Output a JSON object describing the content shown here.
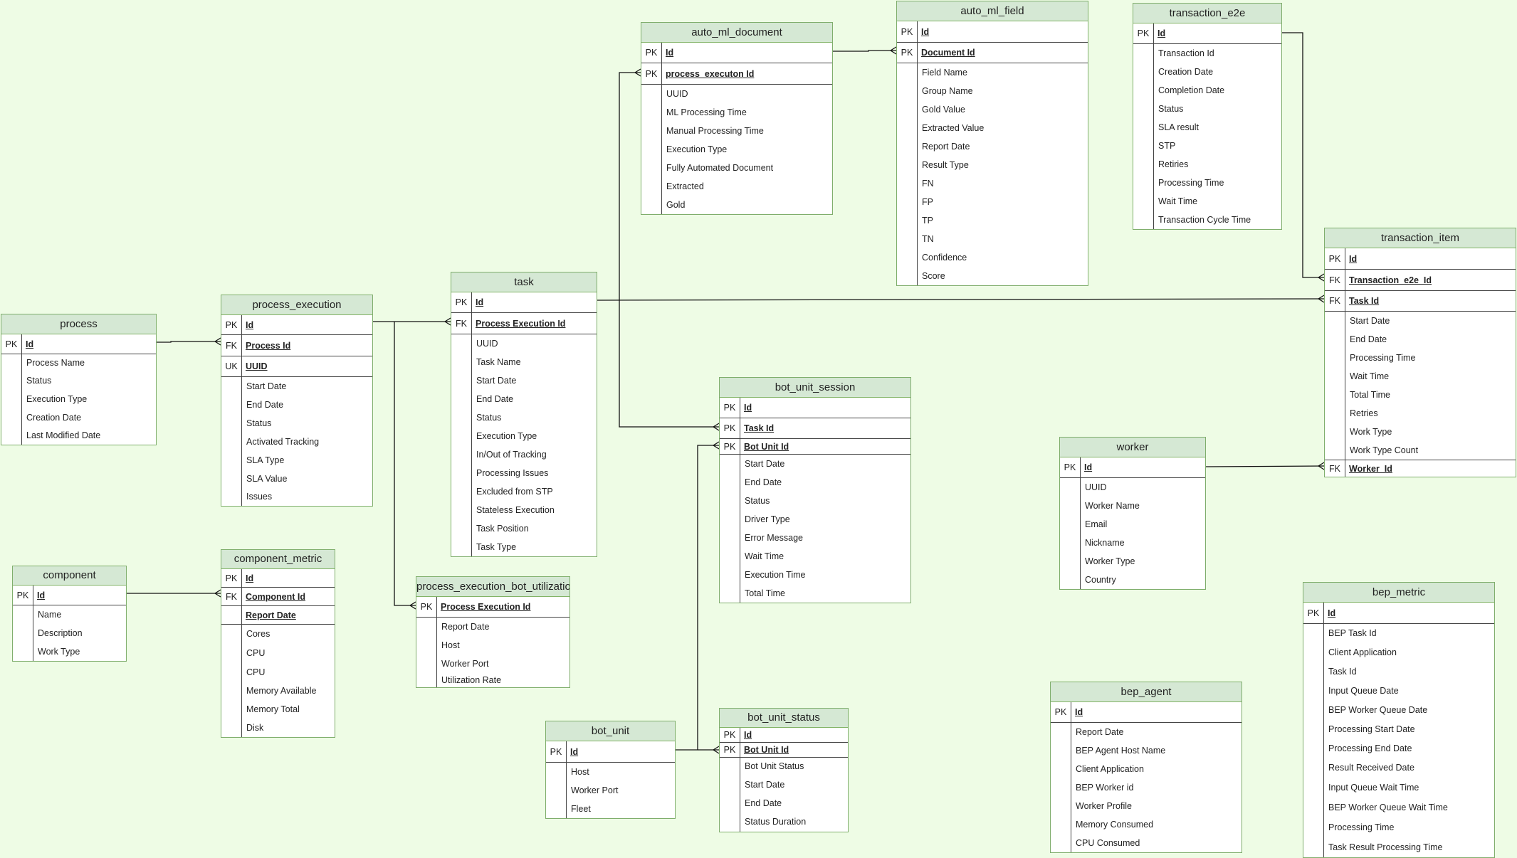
{
  "diagram": {
    "entities": [
      {
        "id": "process",
        "title": "process",
        "keys": [
          [
            "PK",
            "Id"
          ]
        ],
        "attrs": [
          "Process Name",
          "Status",
          "Execution Type",
          "Creation Date",
          "Last Modified Date"
        ]
      },
      {
        "id": "process_execution",
        "title": "process_execution",
        "keys": [
          [
            "PK",
            "Id"
          ],
          [
            "FK",
            "Process Id"
          ],
          [
            "UK",
            "UUID"
          ]
        ],
        "attrs": [
          "Start Date",
          "End Date",
          "Status",
          "Activated Tracking",
          "SLA Type",
          "SLA Value",
          "Issues"
        ]
      },
      {
        "id": "task",
        "title": "task",
        "keys": [
          [
            "PK",
            "Id"
          ],
          [
            "FK",
            "Process Execution Id"
          ]
        ],
        "attrs": [
          "UUID",
          "Task Name",
          "Start Date",
          "End Date",
          "Status",
          "Execution Type",
          "In/Out of Tracking",
          "Processing Issues",
          "Excluded from STP",
          "Stateless Execution",
          "Task Position",
          "Task Type"
        ]
      },
      {
        "id": "auto_ml_document",
        "title": "auto_ml_document",
        "keys": [
          [
            "PK",
            "Id"
          ],
          [
            "PK",
            "process_executon Id"
          ]
        ],
        "attrs": [
          "UUID",
          "ML Processing Time",
          "Manual Processing Time",
          "Execution Type",
          "Fully Automated Document",
          "Extracted",
          "Gold"
        ]
      },
      {
        "id": "auto_ml_field",
        "title": "auto_ml_field",
        "keys": [
          [
            "PK",
            "Id"
          ],
          [
            "PK",
            "Document Id"
          ]
        ],
        "attrs": [
          "Field Name",
          "Group Name",
          "Gold Value",
          "Extracted Value",
          "Report Date",
          "Result Type",
          "FN",
          "FP",
          "TP",
          "TN",
          "Confidence",
          "Score"
        ]
      },
      {
        "id": "transaction_e2e",
        "title": "transaction_e2e",
        "keys": [
          [
            "PK",
            "Id"
          ]
        ],
        "attrs": [
          "Transaction Id",
          "Creation Date",
          "Completion Date",
          "Status",
          "SLA result",
          "STP",
          "Retiries",
          "Processing Time",
          "Wait Time",
          "Transaction Cycle Time"
        ]
      },
      {
        "id": "transaction_item",
        "title": "transaction_item",
        "keys": [
          [
            "PK",
            "Id"
          ],
          [
            "FK",
            "Transaction_e2e_Id"
          ],
          [
            "FK",
            "Task Id"
          ]
        ],
        "attrs": [
          "Start Date",
          "End Date",
          "Processing Time",
          "Wait Time",
          "Total Time",
          "Retries",
          "Work Type",
          "Work Type Count"
        ],
        "trailing_key": [
          "FK",
          "Worker_Id"
        ]
      },
      {
        "id": "bot_unit_session",
        "title": "bot_unit_session",
        "keys": [
          [
            "PK",
            "Id"
          ],
          [
            "PK",
            "Task Id"
          ],
          [
            "PK",
            "Bot Unit Id"
          ]
        ],
        "attrs": [
          "Start Date",
          "End Date",
          "Status",
          "Driver Type",
          "Error Message",
          "Wait Time",
          "Execution Time",
          "Total Time"
        ]
      },
      {
        "id": "worker",
        "title": "worker",
        "keys": [
          [
            "PK",
            "Id"
          ]
        ],
        "attrs": [
          "UUID",
          "Worker Name",
          "Email",
          "Nickname",
          "Worker Type",
          "Country"
        ]
      },
      {
        "id": "component",
        "title": "component",
        "keys": [
          [
            "PK",
            "Id"
          ]
        ],
        "attrs": [
          "Name",
          "Description",
          "Work Type"
        ]
      },
      {
        "id": "component_metric",
        "title": "component_metric",
        "keys": [
          [
            "PK",
            "Id"
          ],
          [
            "FK",
            "Component Id"
          ],
          [
            "",
            "Report Date"
          ]
        ],
        "attrs": [
          "Cores",
          "CPU",
          "CPU",
          "Memory Available",
          "Memory Total",
          "Disk"
        ]
      },
      {
        "id": "process_execution_bot_utilization",
        "title": "process_execution_bot_utilization",
        "keys": [
          [
            "PK",
            "Process Execution Id"
          ]
        ],
        "attrs": [
          "Report Date",
          "Host",
          "Worker Port",
          "Utilization Rate"
        ]
      },
      {
        "id": "bot_unit",
        "title": "bot_unit",
        "keys": [
          [
            "PK",
            "Id"
          ]
        ],
        "attrs": [
          "Host",
          "Worker Port",
          "Fleet"
        ]
      },
      {
        "id": "bot_unit_status",
        "title": "bot_unit_status",
        "keys": [
          [
            "PK",
            "Id"
          ],
          [
            "PK",
            "Bot Unit Id"
          ]
        ],
        "attrs": [
          "Bot Unit Status",
          "Start Date",
          "End Date",
          "Status Duration"
        ]
      },
      {
        "id": "bep_agent",
        "title": "bep_agent",
        "keys": [
          [
            "PK",
            "Id"
          ]
        ],
        "attrs": [
          "Report Date",
          "BEP Agent Host Name",
          "Client Application",
          "BEP Worker id",
          "Worker Profile",
          "Memory Consumed",
          "CPU Consumed"
        ]
      },
      {
        "id": "bep_metric",
        "title": "bep_metric",
        "keys": [
          [
            "PK",
            "Id"
          ]
        ],
        "attrs": [
          "BEP Task Id",
          "Client Application",
          "Task Id",
          "Input Queue Date",
          "BEP Worker Queue Date",
          "Processing Start Date",
          "Processing End Date",
          "Result Received Date",
          "Input Queue Wait Time",
          "BEP Worker Queue Wait Time",
          "Processing Time",
          "Task Result Processing Time"
        ]
      }
    ],
    "relationships": [
      {
        "from": "process",
        "to": "process_execution"
      },
      {
        "from": "process_execution",
        "to": "task"
      },
      {
        "from": "process_execution",
        "to": "process_execution_bot_utilization"
      },
      {
        "from": "process_execution",
        "to": "auto_ml_document"
      },
      {
        "from": "process_execution",
        "to": "bot_unit_session"
      },
      {
        "from": "auto_ml_document",
        "to": "auto_ml_field"
      },
      {
        "from": "task",
        "to": "transaction_item"
      },
      {
        "from": "transaction_e2e",
        "to": "transaction_item"
      },
      {
        "from": "worker",
        "to": "transaction_item"
      },
      {
        "from": "component",
        "to": "component_metric"
      },
      {
        "from": "bot_unit",
        "to": "bot_unit_session"
      },
      {
        "from": "bot_unit",
        "to": "bot_unit_status"
      }
    ]
  }
}
